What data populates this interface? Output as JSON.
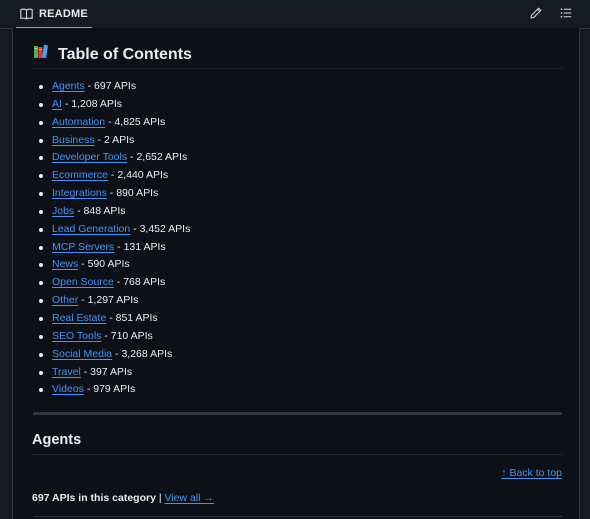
{
  "header": {
    "tab_label": "README",
    "accent_color": "#f78166"
  },
  "toc": {
    "emoji": "books-icon",
    "title": "Table of Contents",
    "items": [
      {
        "label": "Agents",
        "suffix": " - 697 APIs"
      },
      {
        "label": "AI",
        "suffix": " - 1,208 APIs"
      },
      {
        "label": "Automation",
        "suffix": " - 4,825 APIs"
      },
      {
        "label": "Business",
        "suffix": " - 2 APIs"
      },
      {
        "label": "Developer Tools",
        "suffix": " - 2,652 APIs"
      },
      {
        "label": "Ecommerce",
        "suffix": " - 2,440 APIs"
      },
      {
        "label": "Integrations",
        "suffix": " - 890 APIs"
      },
      {
        "label": "Jobs",
        "suffix": " - 848 APIs"
      },
      {
        "label": "Lead Generation",
        "suffix": " - 3,452 APIs"
      },
      {
        "label": "MCP Servers",
        "suffix": " - 131 APIs"
      },
      {
        "label": "News",
        "suffix": " - 590 APIs"
      },
      {
        "label": "Open Source",
        "suffix": " - 768 APIs"
      },
      {
        "label": "Other",
        "suffix": " - 1,297 APIs"
      },
      {
        "label": "Real Estate",
        "suffix": " - 851 APIs"
      },
      {
        "label": "SEO Tools",
        "suffix": " - 710 APIs"
      },
      {
        "label": "Social Media",
        "suffix": " - 3,268 APIs"
      },
      {
        "label": "Travel",
        "suffix": " - 397 APIs"
      },
      {
        "label": "Videos",
        "suffix": " - 979 APIs"
      }
    ]
  },
  "agents": {
    "heading": "Agents",
    "back_to_top": "↑ Back to top",
    "count_text": "697 APIs in this category",
    "separator": " | ",
    "view_all": "View all →"
  },
  "colors": {
    "link": "#4493f8",
    "text": "#e6edf3",
    "background": "#0d1117"
  }
}
